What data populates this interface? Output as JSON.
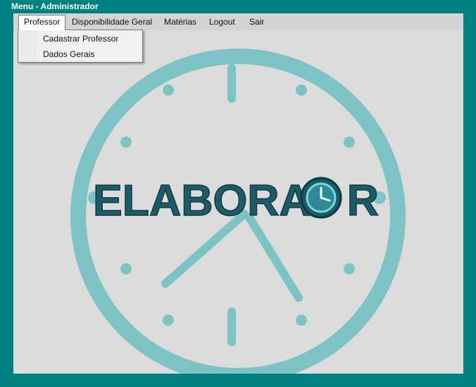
{
  "window": {
    "title": "Menu - Administrador"
  },
  "menu": {
    "items": [
      {
        "label": "Professor"
      },
      {
        "label": "Disponibilidade Geral"
      },
      {
        "label": "Matérias"
      },
      {
        "label": "Logout"
      },
      {
        "label": "Sair"
      }
    ],
    "dropdown": [
      {
        "label": "Cadastrar Professor"
      },
      {
        "label": "Dados Gerais"
      }
    ]
  },
  "logo": {
    "text": "ELABORAT R"
  },
  "colors": {
    "background": "#00807f",
    "clock": "#7dc3c5",
    "client": "#dcdcdc"
  }
}
